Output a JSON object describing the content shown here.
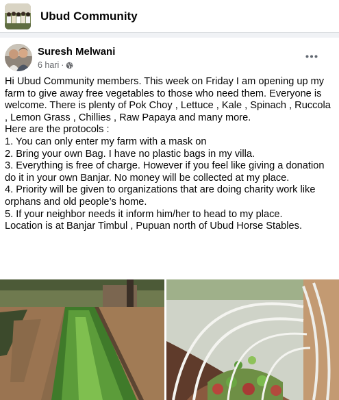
{
  "group": {
    "name": "Ubud Community",
    "avatar_icon": "group-photo-icon"
  },
  "post": {
    "author": "Suresh Melwani",
    "time": "6 hari",
    "separator": "·",
    "privacy_icon": "globe-icon",
    "more_icon": "more-options-icon",
    "lines": [
      "Hi Ubud Community members. This week on Friday I am opening up my farm to give away free vegetables to those who need them. Everyone is welcome. There is plenty of Pok Choy , Lettuce , Kale , Spinach , Ruccola , Lemon Grass , Chillies , Raw Papaya and many more.",
      "Here are the protocols :",
      "1. You can only enter my farm with a mask on",
      "2. Bring your own Bag. I have no plastic bags in my villa.",
      "3. Everything is free of charge. However if you feel like giving a donation do it in your own Banjar. No money will be collected at my place.",
      "4. Priority will be given to organizations that are doing charity work like orphans and old people’s home.",
      "5. If your neighbor needs it inform him/her to head to my place.",
      "Location is at Banjar Timbul , Pupuan north of Ubud Horse Stables."
    ],
    "photos": [
      "vegetable-beds-photo",
      "greenhouse-hoops-photo"
    ]
  },
  "colors": {
    "background": "#f0f2f5",
    "card": "#ffffff",
    "text": "#050505",
    "secondary": "#65676b"
  }
}
